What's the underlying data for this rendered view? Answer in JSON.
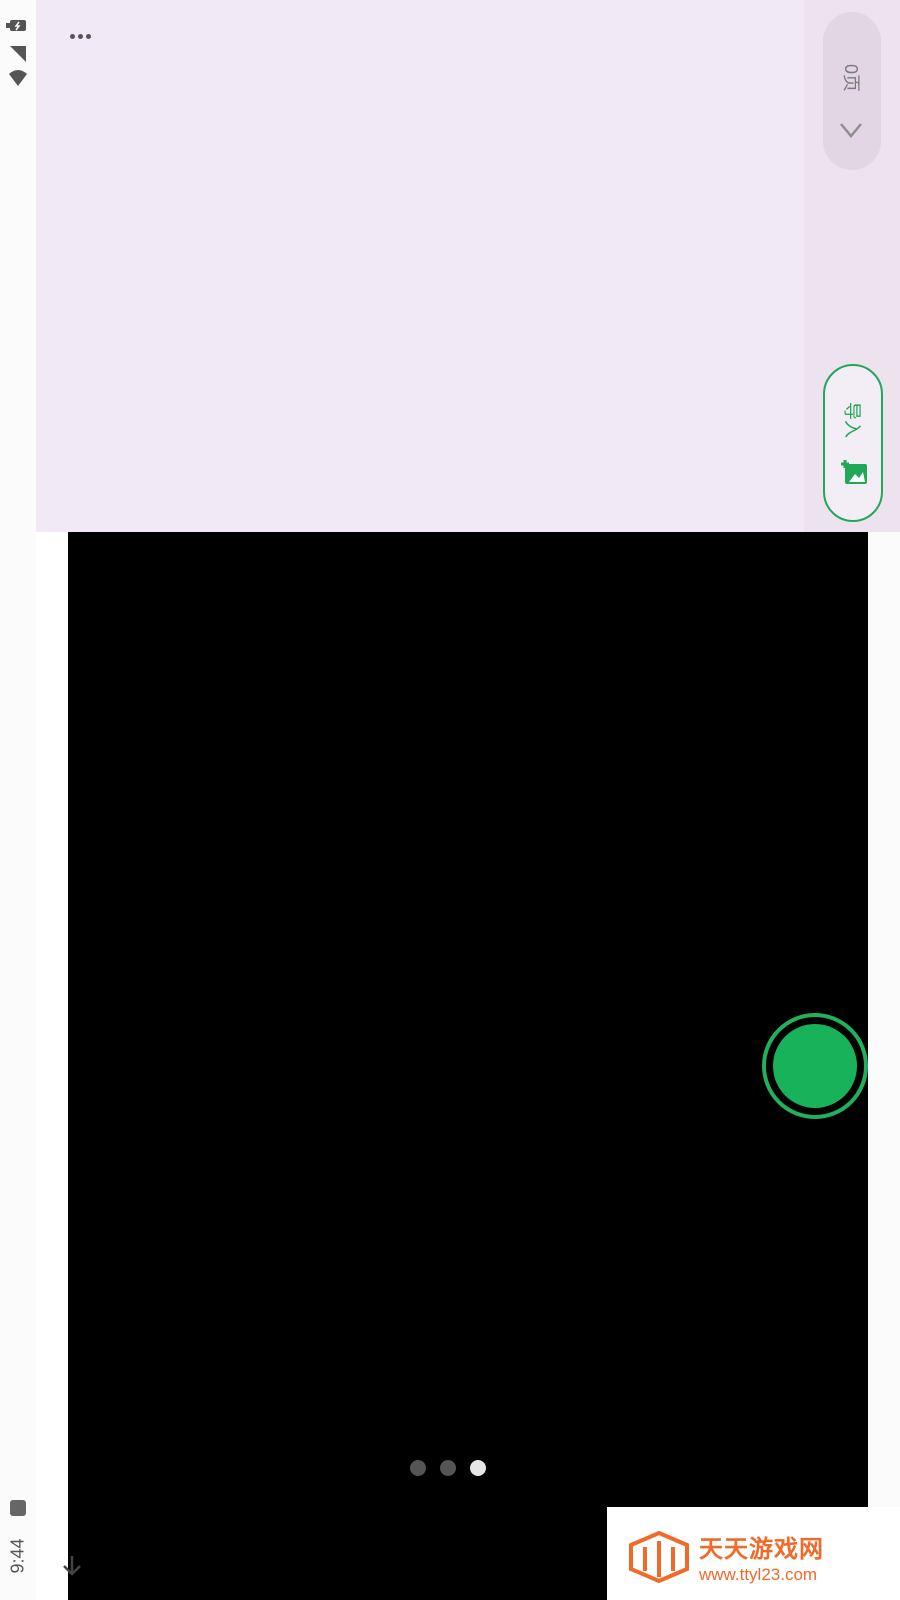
{
  "status_bar": {
    "time": "9:44",
    "icons": [
      "signal-icon",
      "wifi-icon",
      "battery-icon",
      "notification-icon"
    ]
  },
  "top_panel": {
    "more_icon": "more-dots-icon",
    "page_counter": {
      "label": "0页",
      "icon": "chevron-icon"
    },
    "import_button": {
      "label": "导入",
      "icon": "add-image-icon"
    }
  },
  "camera": {
    "shutter_icon": "shutter-icon",
    "page_dots": [
      {
        "active": false
      },
      {
        "active": false
      },
      {
        "active": true
      }
    ],
    "bottom_icon": "arrow-down-icon"
  },
  "watermark": {
    "title": "天天游戏网",
    "url": "www.ttyl23.com"
  },
  "colors": {
    "panel": "#f1e9f5",
    "accent_green": "#22a759",
    "watermark_orange": "#f06a2a"
  }
}
